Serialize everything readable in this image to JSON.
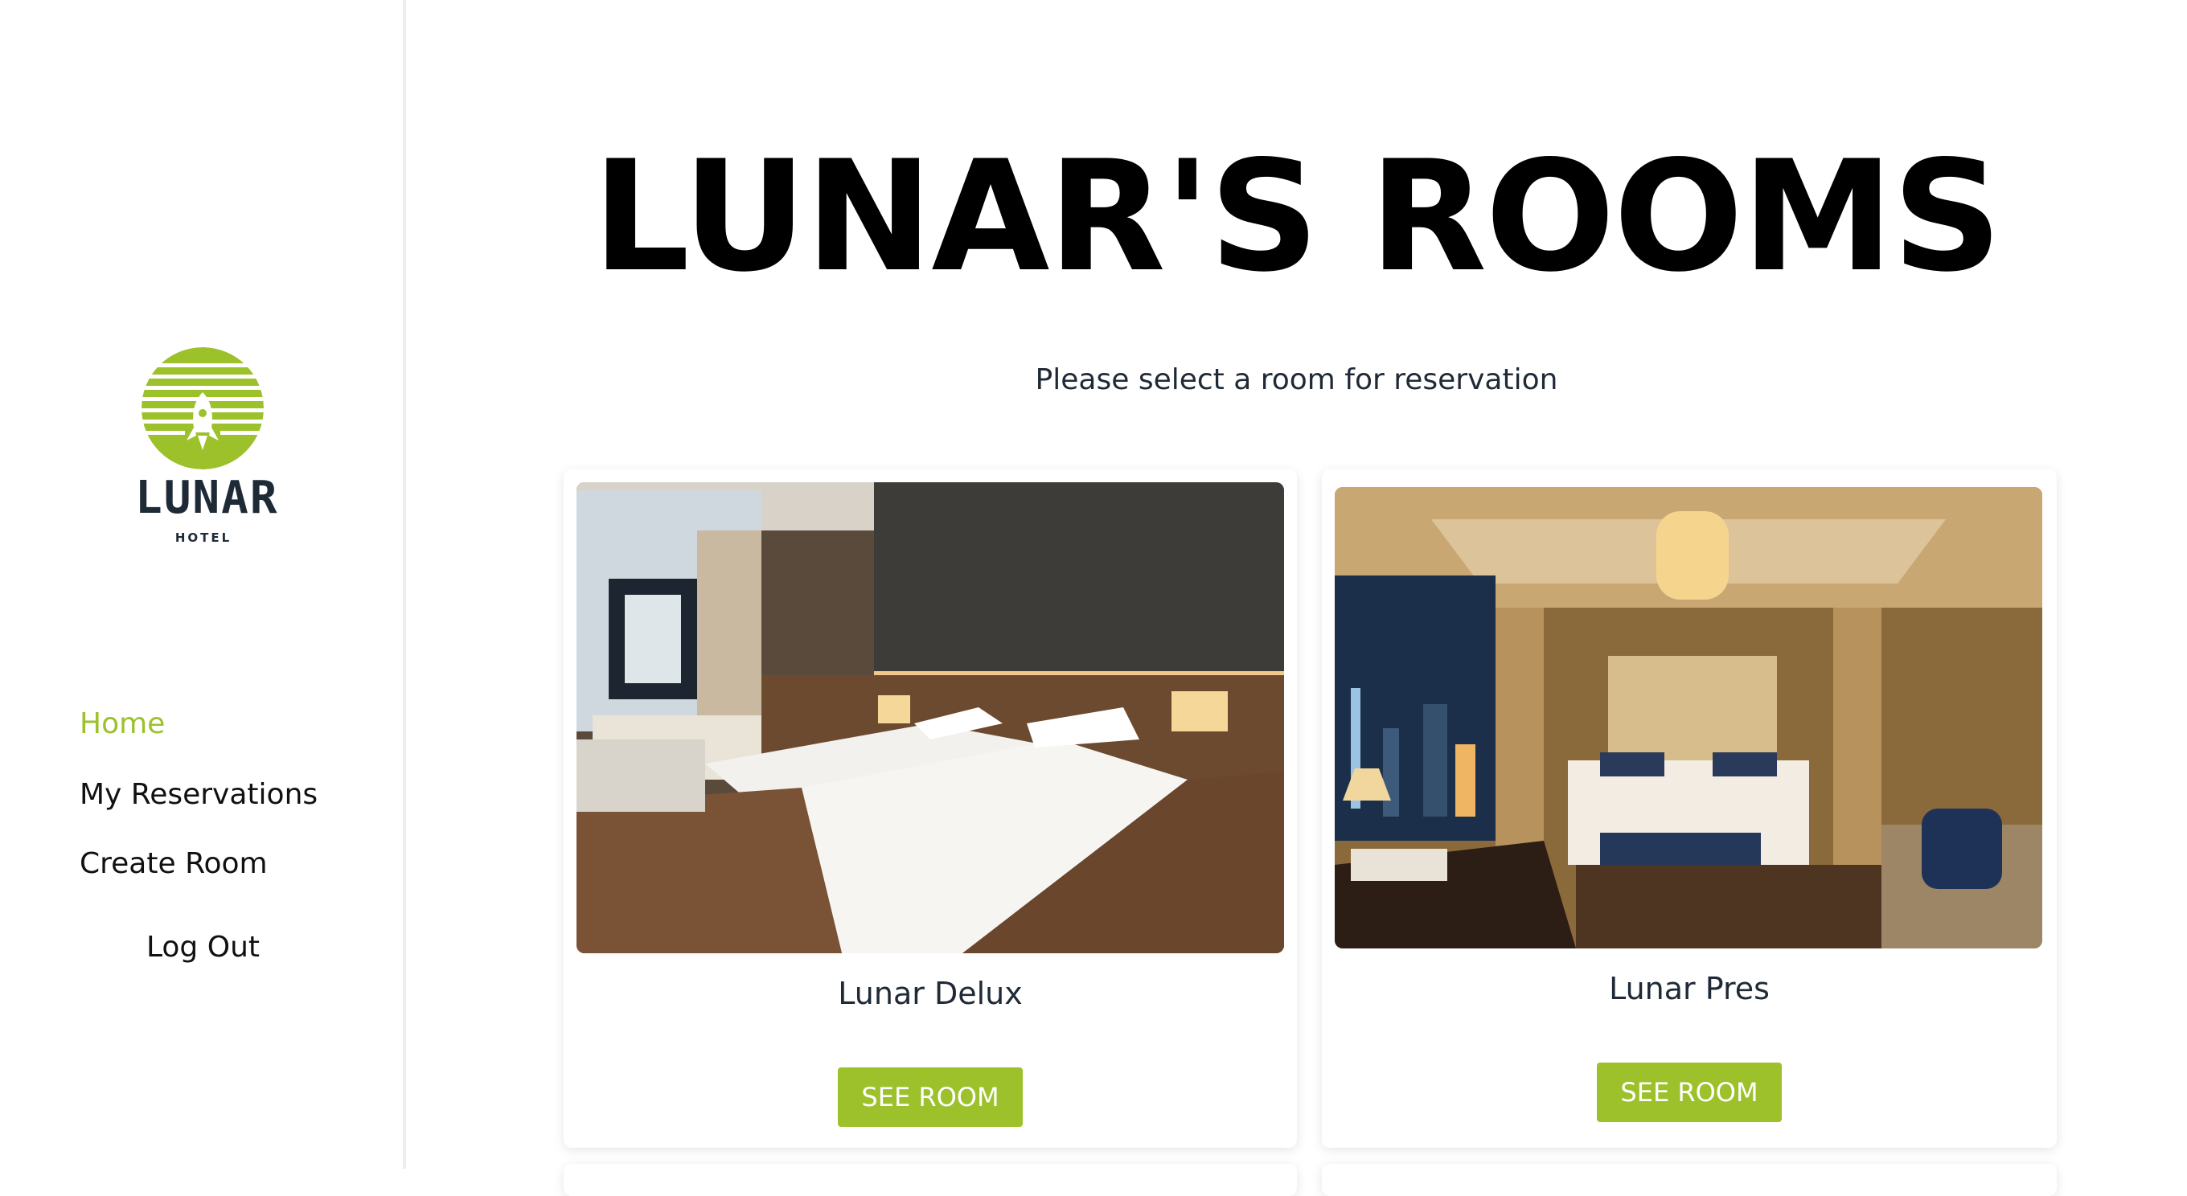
{
  "brand": {
    "logo_name": "LUNAR",
    "logo_sub": "HOTEL",
    "accent_color": "#9cc12b",
    "icon": "rocket-moon-logo"
  },
  "nav": {
    "home": "Home",
    "reservations": "My Reservations",
    "create_room": "Create Room",
    "logout": "Log Out"
  },
  "main": {
    "title": "LUNAR'S ROOMS",
    "subtitle": "Please select a room for reservation"
  },
  "rooms": [
    {
      "name": "Lunar Delux",
      "button": "SEE ROOM",
      "image": "twin-bed-room-photo"
    },
    {
      "name": "Lunar Pres",
      "button": "SEE ROOM",
      "image": "presidential-suite-photo"
    }
  ]
}
